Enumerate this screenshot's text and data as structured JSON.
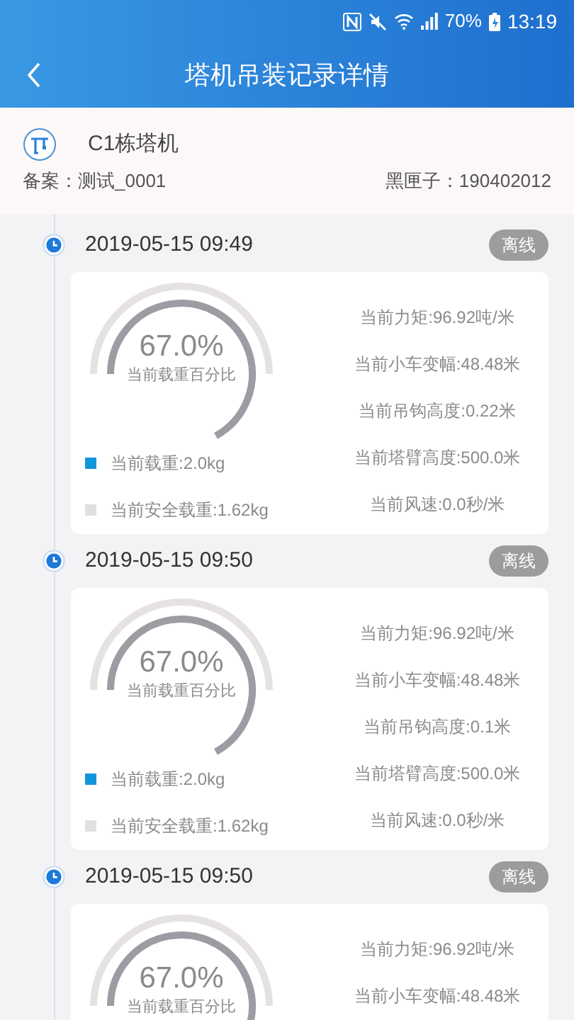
{
  "status_bar": {
    "battery": "70%",
    "time": "13:19"
  },
  "header": {
    "title": "塔机吊装记录详情"
  },
  "crane": {
    "name": "C1栋塔机",
    "record": "备案：测试_0001",
    "black_box": "黑匣子：190402012"
  },
  "records": [
    {
      "datetime": "2019-05-15 09:49",
      "status": "离线",
      "gauge": {
        "percent": "67.0%",
        "label": "当前载重百分比"
      },
      "legend": [
        {
          "label": "当前载重:2.0kg",
          "color": "#1296db"
        },
        {
          "label": "当前安全载重:1.62kg",
          "color": "#e0e0e0"
        }
      ],
      "metrics": [
        "当前力矩:96.92吨/米",
        "当前小车变幅:48.48米",
        "当前吊钩高度:0.22米",
        "当前塔臂高度:500.0米",
        "当前风速:0.0秒/米"
      ]
    },
    {
      "datetime": "2019-05-15 09:50",
      "status": "离线",
      "gauge": {
        "percent": "67.0%",
        "label": "当前载重百分比"
      },
      "legend": [
        {
          "label": "当前载重:2.0kg",
          "color": "#1296db"
        },
        {
          "label": "当前安全载重:1.62kg",
          "color": "#e0e0e0"
        }
      ],
      "metrics": [
        "当前力矩:96.92吨/米",
        "当前小车变幅:48.48米",
        "当前吊钩高度:0.1米",
        "当前塔臂高度:500.0米",
        "当前风速:0.0秒/米"
      ]
    },
    {
      "datetime": "2019-05-15 09:50",
      "status": "离线",
      "gauge": {
        "percent": "67.0%",
        "label": "当前载重百分比"
      },
      "metrics": [
        "当前力矩:96.92吨/米",
        "当前小车变幅:48.48米"
      ]
    }
  ]
}
